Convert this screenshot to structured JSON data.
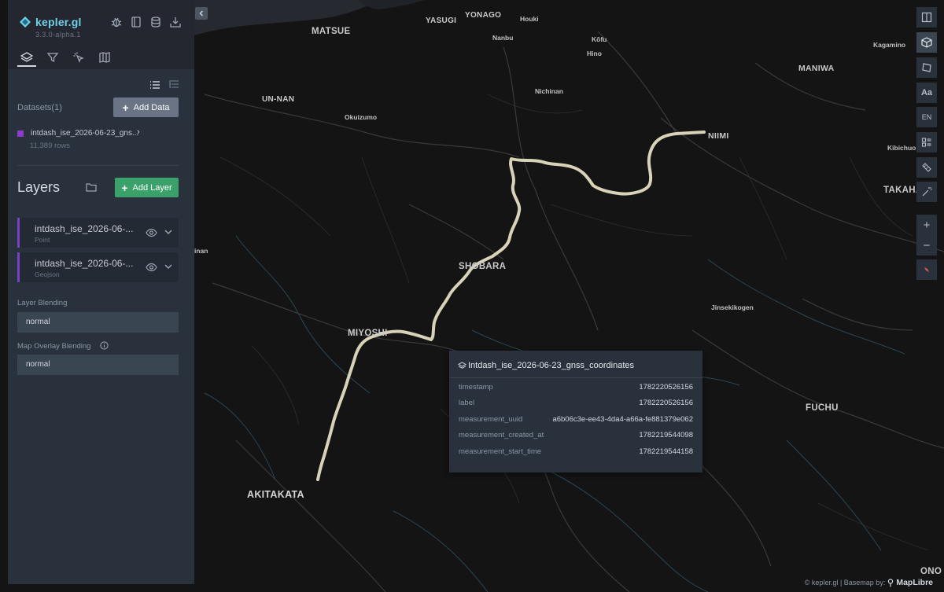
{
  "app": {
    "name": "kepler.gl",
    "version": "3.3.0-alpha.1"
  },
  "datasets": {
    "title": "Datasets(1)",
    "add_button": "Add Data",
    "items": [
      {
        "name": "intdash_ise_2026-06-23_gns...",
        "rows": "11,389 rows",
        "color": "#8c3cc9"
      }
    ]
  },
  "layers": {
    "title": "Layers",
    "add_button": "Add Layer",
    "items": [
      {
        "title": "intdash_ise_2026-06-...",
        "type": "Point"
      },
      {
        "title": "intdash_ise_2026-06-...",
        "type": "Geojson"
      }
    ]
  },
  "blending": {
    "layer_label": "Layer Blending",
    "layer_value": "normal",
    "overlay_label": "Map Overlay Blending",
    "overlay_value": "normal"
  },
  "map_controls": {
    "locale": "EN",
    "text_layer": "Aa",
    "zoom_in": "+",
    "zoom_out": "−"
  },
  "tooltip": {
    "title": "Intdash_ise_2026-06-23_gnss_coordinates",
    "rows": [
      {
        "key": "timestamp",
        "value": "1782220526156"
      },
      {
        "key": "label",
        "value": "1782220526156"
      },
      {
        "key": "measurement_uuid",
        "value": "a6b06c3e-ee43-4da4-a66a-fe881379e062"
      },
      {
        "key": "measurement_created_at",
        "value": "1782219544098"
      },
      {
        "key": "measurement_start_time",
        "value": "1782219544158"
      }
    ]
  },
  "map_labels": {
    "matsue": "MATSUE",
    "yasugi": "YASUGI",
    "yonago": "YONAGO",
    "houki": "Houki",
    "nanbu": "Nanbu",
    "kofu": "Kōfu",
    "hino": "Hino",
    "kagamino": "Kagamino",
    "maniwa": "MANIWA",
    "un_nan": "UN-NAN",
    "nichinan": "Nichinan",
    "okuizumo": "Okuizumo",
    "niimi": "NIIMI",
    "kibichuo": "Kibichuo",
    "takaha": "TAKAHA",
    "inan": "inan",
    "shobara": "SHOBARA",
    "jinsekikogen": "Jinsekikogen",
    "miyoshi": "MIYOSHI",
    "fuchu": "FUCHU",
    "akitakata": "AKITAKATA",
    "ono": "ONO"
  },
  "attribution": {
    "kepler": "© kepler.gl | Basemap by:",
    "maplibre": "MapLibre"
  },
  "colors": {
    "panel": "#29323c",
    "panel_header": "#242730",
    "accent": "#6fd0e8",
    "layer_bar": "#7a3fc7",
    "track": "#d8d2b8",
    "add_layer": "#3aa16b"
  }
}
